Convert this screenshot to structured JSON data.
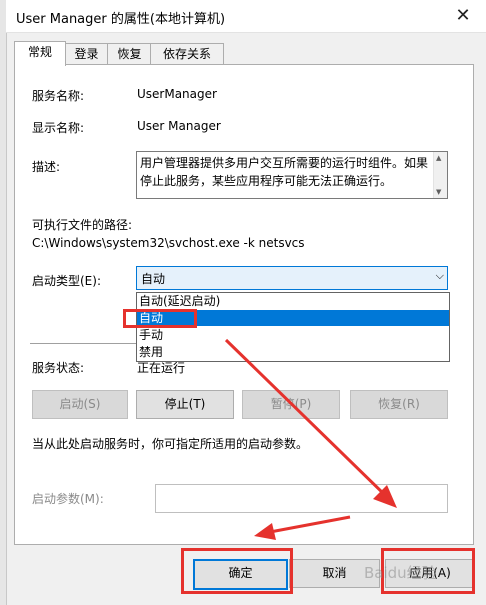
{
  "window": {
    "title": "User Manager 的属性(本地计算机)"
  },
  "tabs": [
    {
      "label": "常规"
    },
    {
      "label": "登录"
    },
    {
      "label": "恢复"
    },
    {
      "label": "依存关系"
    }
  ],
  "general": {
    "service_name_label": "服务名称:",
    "service_name_value": "UserManager",
    "display_name_label": "显示名称:",
    "display_name_value": "User Manager",
    "description_label": "描述:",
    "description_value": "用户管理器提供多用户交互所需要的运行时组件。如果停止此服务，某些应用程序可能无法正确运行。",
    "path_label": "可执行文件的路径:",
    "path_value": "C:\\Windows\\system32\\svchost.exe -k netsvcs",
    "startup_type_label": "启动类型(E):",
    "startup_type_value": "自动",
    "startup_options": [
      "自动(延迟启动)",
      "自动",
      "手动",
      "禁用"
    ],
    "service_status_label": "服务状态:",
    "service_status_value": "正在运行",
    "start_button": "启动(S)",
    "stop_button": "停止(T)",
    "pause_button": "暂停(P)",
    "resume_button": "恢复(R)",
    "hint_text": "当从此处启动服务时，你可指定所适用的启动参数。",
    "start_params_label": "启动参数(M):",
    "start_params_value": ""
  },
  "footer": {
    "ok_button": "确定",
    "cancel_button": "取消",
    "apply_button": "应用(A)"
  },
  "watermark": "Baidu经验",
  "colors": {
    "accent": "#0078d7",
    "annotation_red": "#e5322d"
  }
}
